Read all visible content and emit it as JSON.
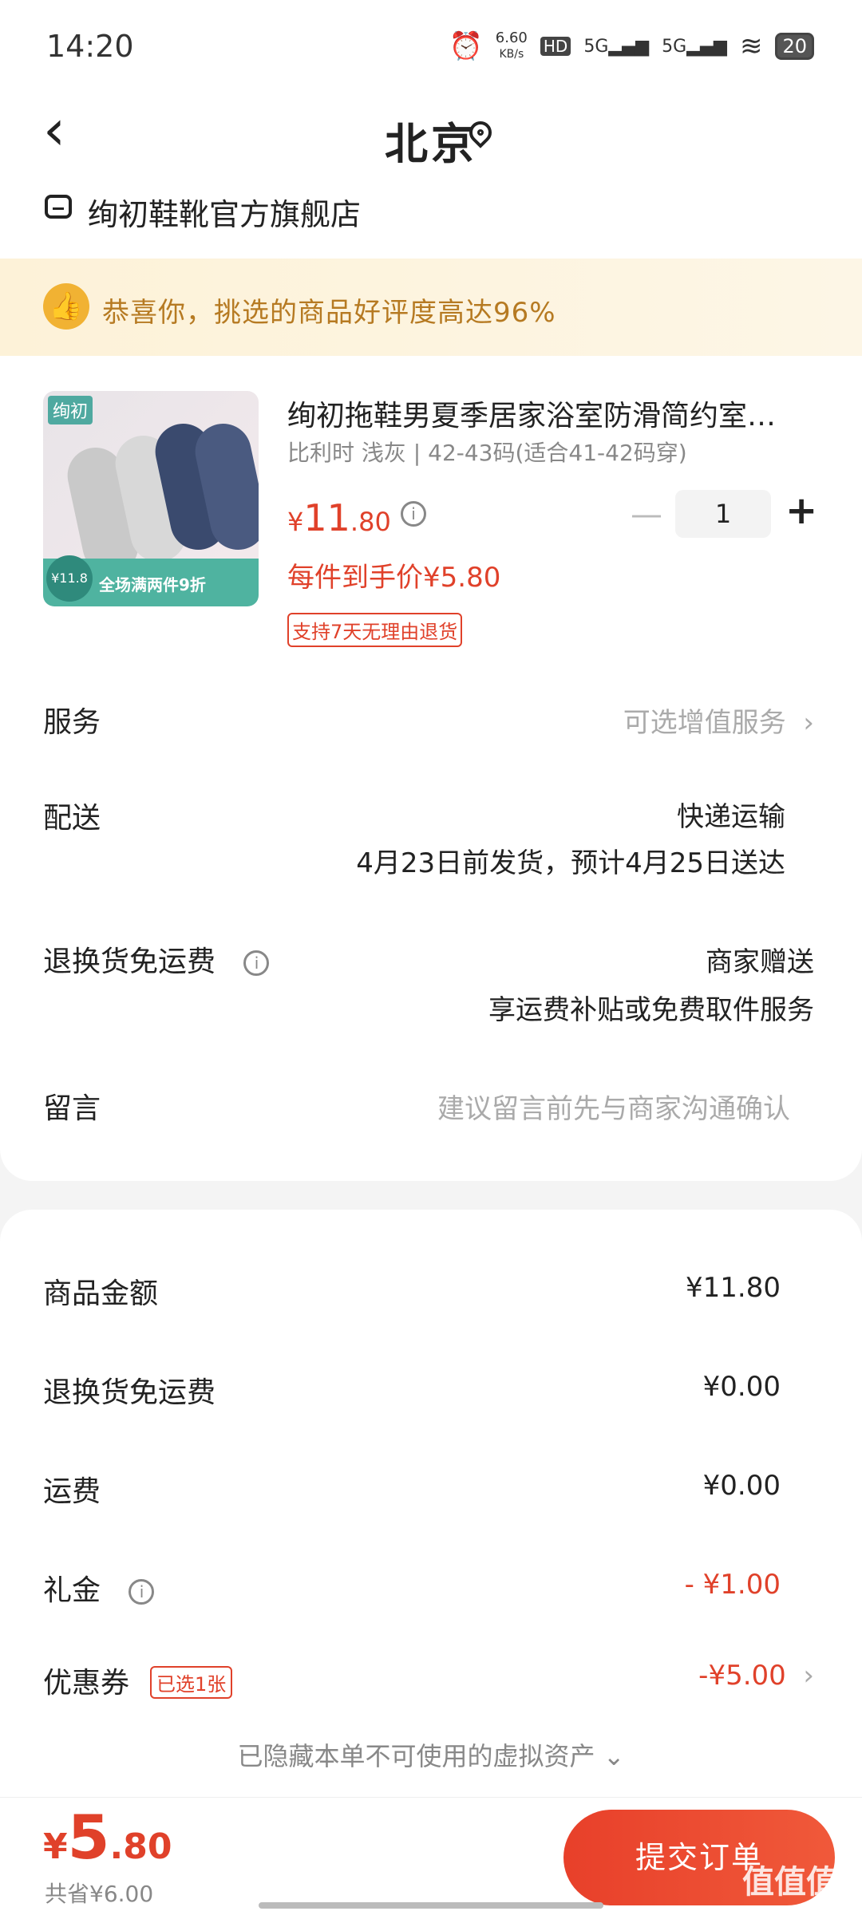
{
  "status_bar": {
    "time": "14:20",
    "net_speed_value": "6.60",
    "net_speed_unit": "KB/s",
    "hd": "HD",
    "signal1": "5G",
    "signal2": "5G",
    "battery": "20"
  },
  "header": {
    "back_icon": "‹",
    "city": "北京",
    "store_name": "绚初鞋靴官方旗舰店"
  },
  "banner": {
    "text": "恭喜你，挑选的商品好评度高达96%"
  },
  "product": {
    "image_brand": "绚初",
    "image_price": "¥11.8",
    "image_promo": "全场满两件9折",
    "title": "绚初拖鞋男夏季居家浴室防滑简约室…",
    "spec": "比利时 浅灰 | 42-43码(适合41-42码穿)",
    "price_symbol": "¥",
    "price_int": "11",
    "price_dec": ".80",
    "quantity": "1",
    "minus": "—",
    "plus": "+",
    "unit_price": "每件到手价¥5.80",
    "return_policy": "支持7天无理由退货"
  },
  "rows": {
    "service_label": "服务",
    "service_value": "可选增值服务",
    "delivery_label": "配送",
    "delivery_method": "快递运输",
    "delivery_time": "4月23日前发货，预计4月25日送达",
    "return_shipping_label": "退换货免运费",
    "return_shipping_value": "商家赠送",
    "return_shipping_detail": "享运费补贴或免费取件服务",
    "message_label": "留言",
    "message_placeholder": "建议留言前先与商家沟通确认"
  },
  "summary": {
    "goods_label": "商品金额",
    "goods_value": "¥11.80",
    "return_label": "退换货免运费",
    "return_value": "¥0.00",
    "shipping_label": "运费",
    "shipping_value": "¥0.00",
    "gift_label": "礼金",
    "gift_value": "- ¥1.00",
    "coupon_label": "优惠券",
    "coupon_tag": "已选1张",
    "coupon_value": "-¥5.00",
    "hidden_assets": "已隐藏本单不可使用的虚拟资产"
  },
  "footer": {
    "total_symbol": "¥",
    "total_int": "5",
    "total_dec": ".80",
    "saved": "共省¥6.00",
    "submit": "提交订单",
    "watermark": "值值值"
  },
  "colors": {
    "accent": "#e0412a",
    "banner_text": "#b67a22",
    "banner_bg": "#fdf2d8"
  }
}
